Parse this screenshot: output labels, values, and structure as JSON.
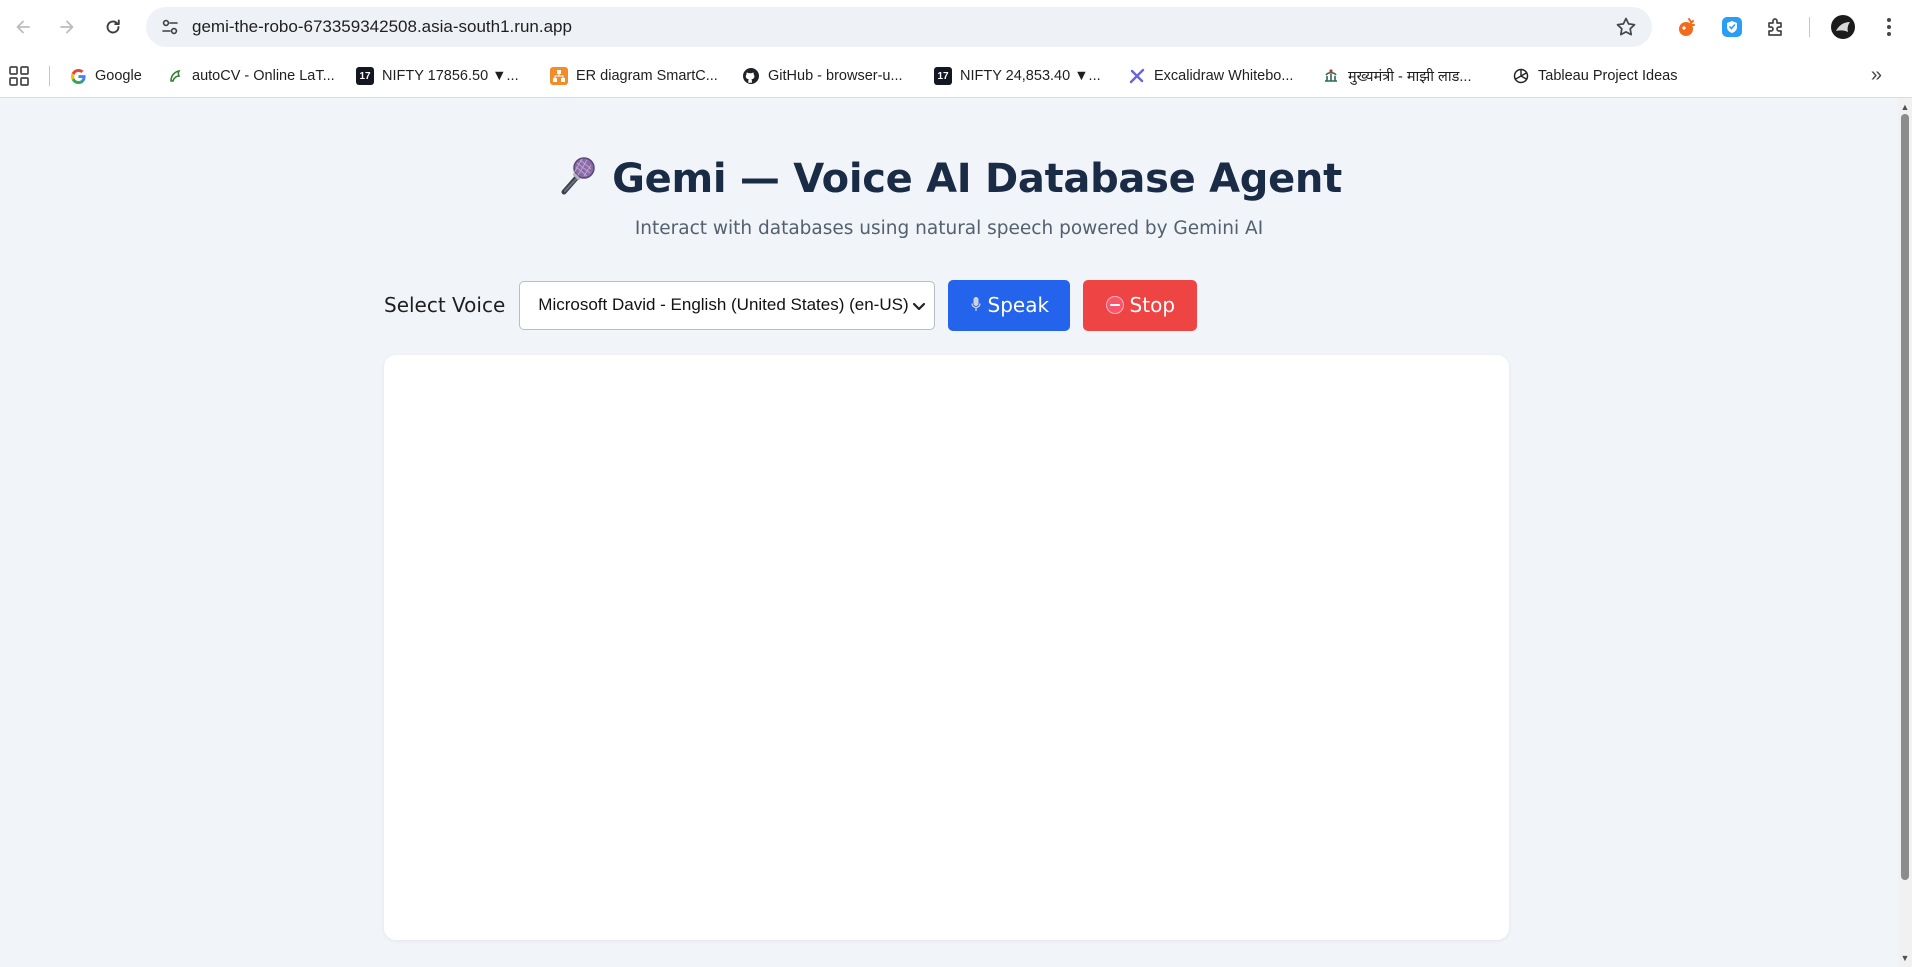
{
  "browser": {
    "url": "gemi-the-robo-673359342508.asia-south1.run.app",
    "bookmarks": [
      {
        "label": "Google",
        "icon": "google-icon"
      },
      {
        "label": "autoCV - Online LaT...",
        "icon": "autocv-icon"
      },
      {
        "label": "NIFTY 17856.50 ▼...",
        "icon": "tradingview-icon"
      },
      {
        "label": "ER diagram SmartC...",
        "icon": "smartdraw-icon"
      },
      {
        "label": "GitHub - browser-u...",
        "icon": "github-icon"
      },
      {
        "label": "NIFTY 24,853.40 ▼...",
        "icon": "tradingview-icon"
      },
      {
        "label": "Excalidraw Whitebo...",
        "icon": "excalidraw-icon"
      },
      {
        "label": "मुख्यमंत्री - माझी लाड...",
        "icon": "government-emblem-icon"
      },
      {
        "label": "Tableau Project Ideas",
        "icon": "openai-icon"
      }
    ]
  },
  "page": {
    "title": "Gemi — Voice AI Database Agent",
    "subtitle": "Interact with databases using natural speech powered by Gemini AI",
    "voice_label": "Select Voice",
    "voice_selected": "Microsoft David - English (United States) (en-US)",
    "speak_label": "Speak",
    "stop_label": "Stop"
  },
  "colors": {
    "background": "#f1f4f9",
    "title": "#1a2b45",
    "speak_button": "#2463eb",
    "stop_button": "#ef4444"
  }
}
